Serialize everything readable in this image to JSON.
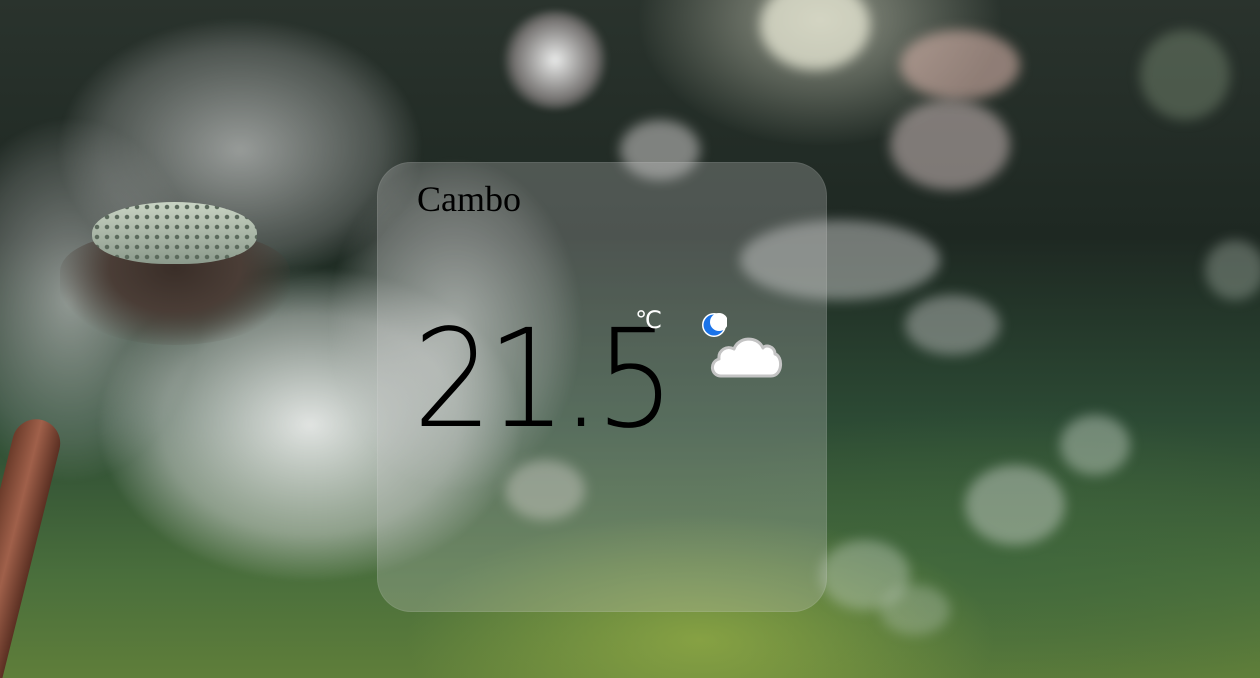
{
  "weather_card": {
    "city": "Cambo",
    "temperature": "21.5",
    "unit": "℃",
    "condition_icon": "night-partly-cloudy-icon"
  },
  "colors": {
    "card_background": "#c8c8c8",
    "temperature_text": "#000000",
    "unit_text": "#ffffff",
    "moon": "#1a73e8"
  }
}
